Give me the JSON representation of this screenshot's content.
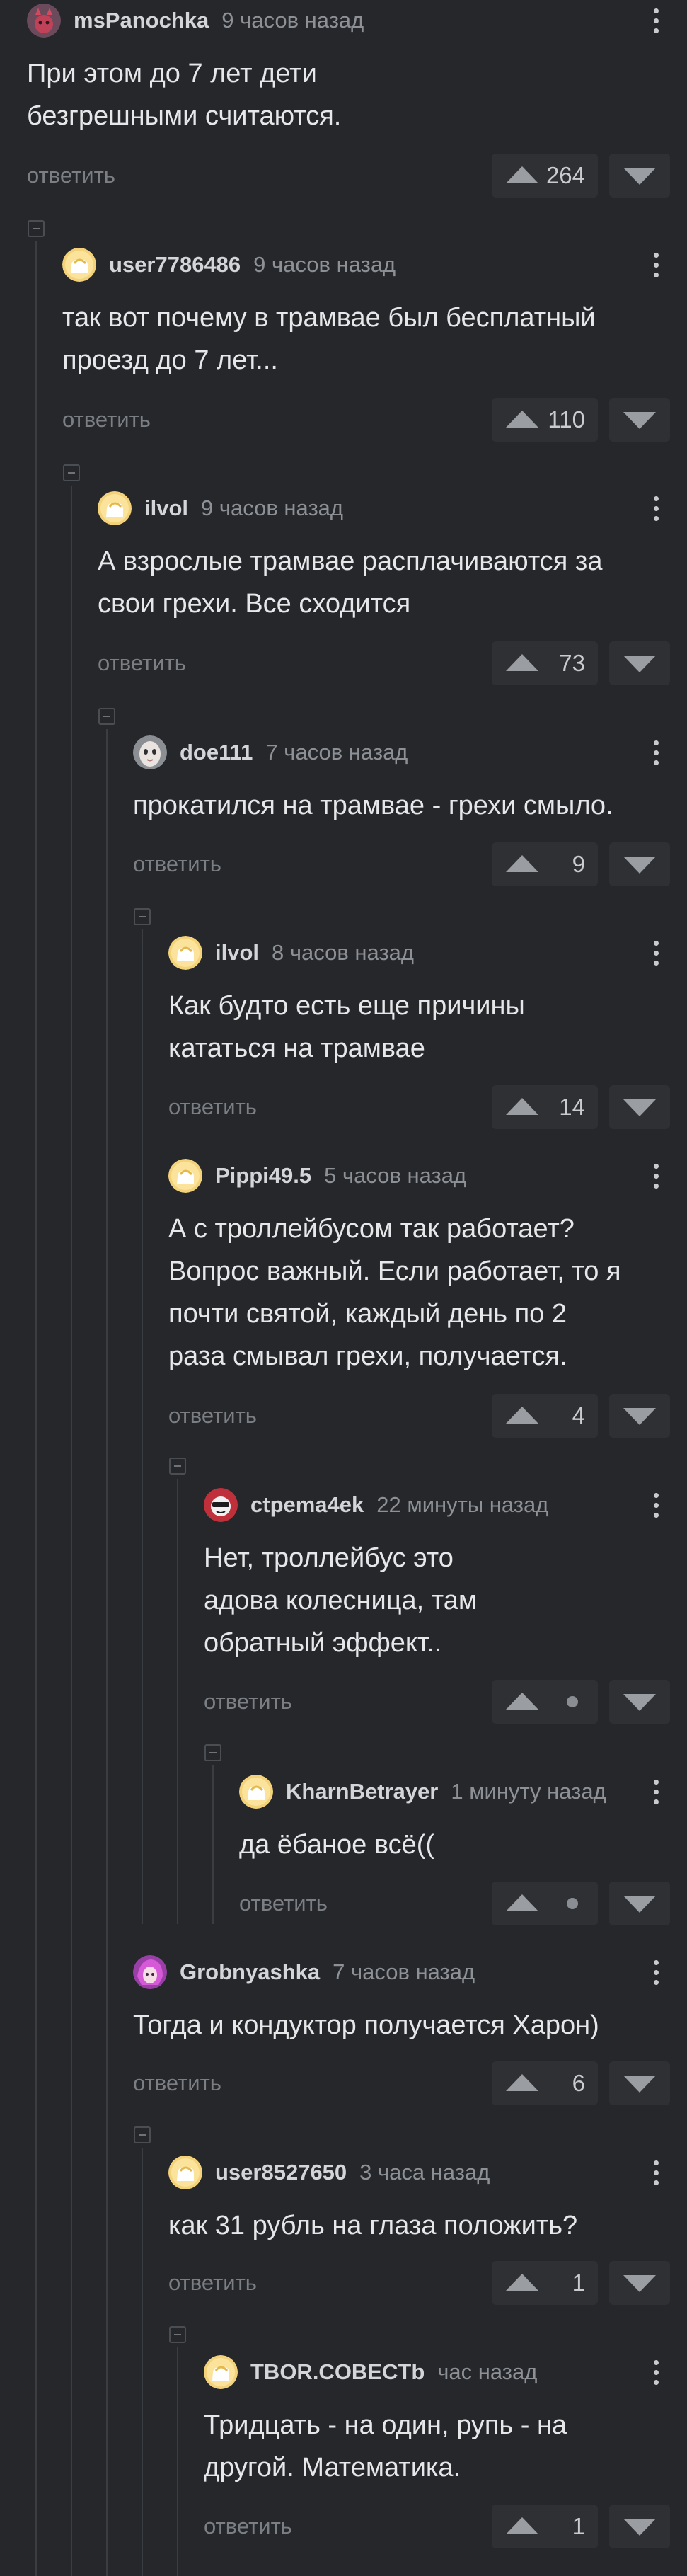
{
  "colors": {
    "background": "#25272b",
    "thread_line": "#3a3d42",
    "vote_bg": "#2e3034",
    "text": "#e6e7e9",
    "muted": "#8d9196"
  },
  "reply_label": "ответить",
  "comments": [
    {
      "user": "msPanochka",
      "time": "9 часов назад",
      "text": "При этом до 7 лет дети\nбезгрешными считаются.",
      "rating": "264",
      "avatar_icon": "devil-avatar-icon"
    },
    {
      "user": "user7786486",
      "time": "9 часов назад",
      "text": "так вот почему в трамвае был бесплатный\nпроезд до 7 лет...",
      "rating": "110",
      "avatar_icon": "default-avatar-icon"
    },
    {
      "user": "ilvol",
      "time": "9 часов назад",
      "text": "А взрослые трамвае расплачиваются за\nсвои грехи. Все сходится",
      "rating": "73",
      "avatar_icon": "default-avatar-icon"
    },
    {
      "user": "doe111",
      "time": "7 часов назад",
      "text": "прокатился на трамвае - грехи смыло.",
      "rating": "9",
      "avatar_icon": "doll-face-avatar-icon"
    },
    {
      "user": "ilvol",
      "time": "8 часов назад",
      "text": "Как будто есть еще причины\nкататься на трамвае",
      "rating": "14",
      "avatar_icon": "default-avatar-icon"
    },
    {
      "user": "Pippi49.5",
      "time": "5 часов назад",
      "text": "А с троллейбусом так работает?\nВопрос важный. Если работает, то я\nпочти святой, каждый день по 2\nраза смывал грехи, получается.",
      "rating": "4",
      "avatar_icon": "default-avatar-icon"
    },
    {
      "user": "ctpema4ek",
      "time": "22 минуты назад",
      "text": "Нет, троллейбус это\nадова колесница, там\nобратный эффект..",
      "rating": "",
      "avatar_icon": "cartoon-avatar-icon"
    },
    {
      "user": "KharnBetrayer",
      "time": "1 минуту назад",
      "text": "да ёбаное всё((",
      "rating": "",
      "avatar_icon": "default-avatar-icon"
    },
    {
      "user": "Grobnyashka",
      "time": "7 часов назад",
      "text": "Тогда и кондуктор получается Харон)",
      "rating": "6",
      "avatar_icon": "anime-avatar-icon"
    },
    {
      "user": "user8527650",
      "time": "3 часа назад",
      "text": "как 31 рубль на глаза положить?",
      "rating": "1",
      "avatar_icon": "default-avatar-icon"
    },
    {
      "user": "TBOR.COBECTb",
      "time": "час назад",
      "text": "Тридцать - на один, рупь - на\nдругой. Математика.",
      "rating": "1",
      "avatar_icon": "default-avatar-icon"
    }
  ]
}
